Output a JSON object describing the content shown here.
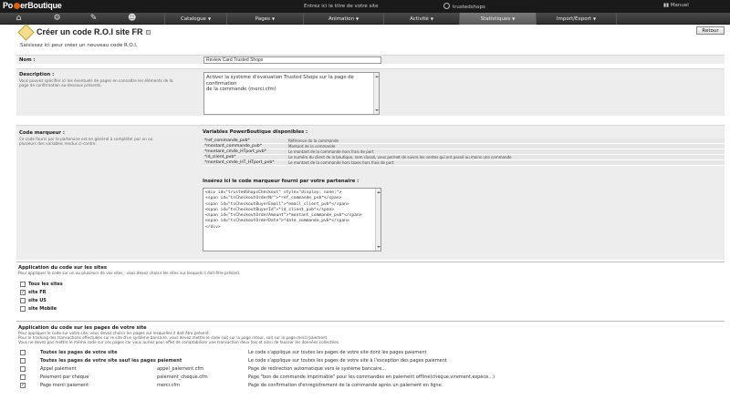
{
  "topbar": {
    "logo_pre": "Po",
    "logo_post": "erBoutique",
    "site_title": "Entrez ici le titre de votre site",
    "shop_name": "trustedshops",
    "exit_label": "Manuel"
  },
  "menu": {
    "icons": [
      "home-icon",
      "gear-icon",
      "tools-icon",
      "users-icon"
    ],
    "items": [
      {
        "label": "Catalogue"
      },
      {
        "label": "Pages"
      },
      {
        "label": "Animation"
      },
      {
        "label": "Activité"
      },
      {
        "label": "Statistiques"
      },
      {
        "label": "Import/Export"
      }
    ]
  },
  "header": {
    "title": "Créer un code R.O.I site FR",
    "help": "?",
    "back_label": "Retour",
    "intro": "Saisissez ici pour créer un nouveau code R.O.I."
  },
  "form": {
    "nom_label": "Nom :",
    "nom_value": "Review Card Trusted Shops",
    "desc_label": "Description :",
    "desc_help": "Vous pouvez spécifier ici les éventuels de pages en connaître les éléments de la page de confirmation au-dessous présents.",
    "desc_value": "Activer la système d'évaluation Trusted Shops sur la page de confirmation\nde la commande (merci.cfm)",
    "code_label": "Code marqueur :",
    "code_help": "Ce code fourni par le partenaire est en général à compléter par un ou plusieurs des variables rendus ci-contre.",
    "vars_title": "Variables PowerBoutique disponibles :",
    "vars": [
      {
        "name": "*ref_commande_pvb*",
        "desc": "Référence de la commande"
      },
      {
        "name": "*montant_commande_pvb*",
        "desc": "Montant de la commande"
      },
      {
        "name": "*montant_cmde_HTport_pvb*",
        "desc": "Le montant de la commande hors frais de port"
      },
      {
        "name": "*id_client_pvb*",
        "desc": "Le numéro du client de la boutique, nom classé, vous permet de suivre les ventes qui ont passé au moins une commande"
      },
      {
        "name": "*montant_cmde_HT_HTport_pvb*",
        "desc": "Le montant de la commande hors taxes hors frais de port"
      }
    ],
    "insert_title": "Insérez ici le code marqueur fourni par votre partenaire :",
    "code_value": "<div id=\"trustedShopsCheckout\" style=\"display: none;\">\n<span id=\"tsCheckoutOrderNr\">*ref_commande_pvb*</span>\n<span id=\"tsCheckoutBuyerEmail\">*email_client_pvb*</span>\n<span id=\"tsCheckoutBuyerId\">*id_client_pvb*</span>\n<span id=\"tsCheckoutOrderAmount\">*montant_commande_pvb*</span>\n<span id=\"tsCheckoutOrderDate\">*date_commande_pvb*</span>\n</div>"
  },
  "sites": {
    "title": "Application du code sur les sites",
    "help": "Pour appliquer le code sur un ou plusieurs de vos sites : vous devez choisir les sites sur lesquels il doit être présent.",
    "options": [
      {
        "label": "Tous les sites",
        "checked": false
      },
      {
        "label": "site FR",
        "checked": true
      },
      {
        "label": "site US",
        "checked": false
      },
      {
        "label": "site Mobile",
        "checked": false
      }
    ]
  },
  "pages": {
    "title": "Application du code sur les pages de votre site",
    "help1": "Pour appliquer le code sur votre site, vous devez choisir les pages sur lesquelles il doit être présent.",
    "help2": "Pour le tracking des transactions effectuées sur le site d'un système bancaire, vous devez mettre le code soit sur la page retour, soit sur la page merci paiement.",
    "help3": "Vous ne devez pas mettre le même code sur ces pages car vous auriez pour effet de comptabiliser une transaction deux fois et ainsi de fausser les données collectées.",
    "rows": [
      {
        "label": "Toutes les pages de votre site",
        "file": "",
        "desc": "Le code s'applique sur toutes les pages de votre site dont les pages paiement",
        "checked": false,
        "bold": true
      },
      {
        "label": "Toutes les pages de votre site sauf les pages paiement",
        "file": "",
        "desc": "Le code s'applique sur toutes les pages de votre site à l'exception des pages paiement",
        "checked": false,
        "bold": true
      },
      {
        "label": "Appel paiement",
        "file": "appel_paiement.cfm",
        "desc": "Page de redirection automatique vers le système bancaire...",
        "checked": false,
        "bold": false
      },
      {
        "label": "Paiement par chèque",
        "file": "paiement_cheque.cfm",
        "desc": "Page \"bon de commande imprimable\" pour les commandes en paiement offline(chèque,virement,espèce...)",
        "checked": false,
        "bold": false
      },
      {
        "label": "Page merci paiement",
        "file": "merci.cfm",
        "desc": "Page de confirmation d'enregistrement de la commande après un paiement en ligne.",
        "checked": true,
        "bold": false
      }
    ]
  }
}
